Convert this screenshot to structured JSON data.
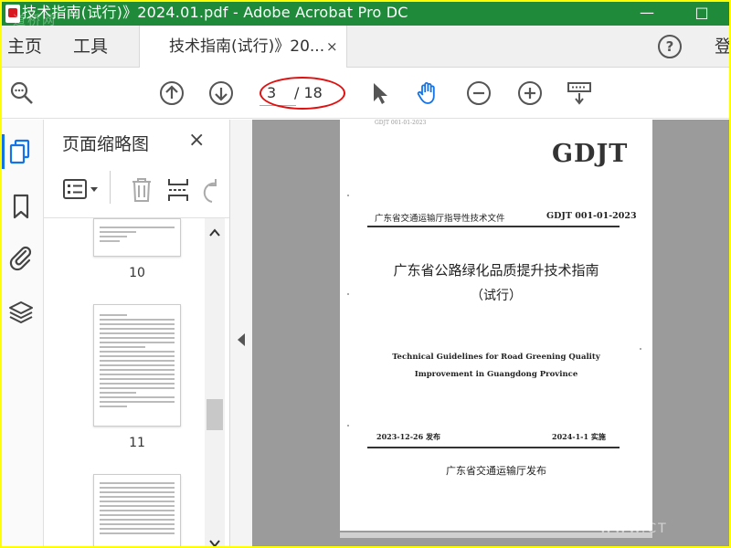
{
  "window": {
    "title": "技术指南(试行)》2024.01.pdf - Adobe Acrobat Pro DC",
    "watermark": "道桥网",
    "minimize": "—",
    "maximize": "□"
  },
  "menu": {
    "home": "主页",
    "tools": "工具",
    "doc_tab_label": "技术指南(试行)》20...",
    "doc_tab_close": "×",
    "help": "?",
    "login": "登"
  },
  "toolbar": {
    "current_page": "3",
    "total_pages": "/ 18",
    "icons": [
      "zoom-search-icon",
      "page-up-icon",
      "page-down-icon",
      "select-cursor-icon",
      "hand-tool-icon",
      "zoom-out-icon",
      "zoom-in-icon",
      "fit-page-icon"
    ]
  },
  "sidebar": {
    "icons": [
      "page-thumbnails-icon",
      "bookmark-icon",
      "attachment-icon",
      "layers-icon"
    ]
  },
  "thumbnails": {
    "title": "页面缩略图",
    "close": "×",
    "pages": [
      {
        "number": "10"
      },
      {
        "number": "11"
      },
      {
        "number": ""
      }
    ]
  },
  "document": {
    "std_tag": "GDJT 001-01-2023",
    "code_big": "GDJT",
    "issuer_line": "广东省交通运输厅指导性技术文件",
    "code_line": "GDJT 001-01-2023",
    "title_cn": "广东省公路绿化品质提升技术指南",
    "subtitle_cn": "（试行）",
    "title_en_1": "Technical Guidelines for Road Greening Quality",
    "title_en_2": "Improvement in Guangdong Province",
    "publish_date": "2023-12-26 发布",
    "implement_date": "2024-1-1 实施",
    "publisher": "广东省交通运输厅发布",
    "watermark": "WWW.CT"
  }
}
